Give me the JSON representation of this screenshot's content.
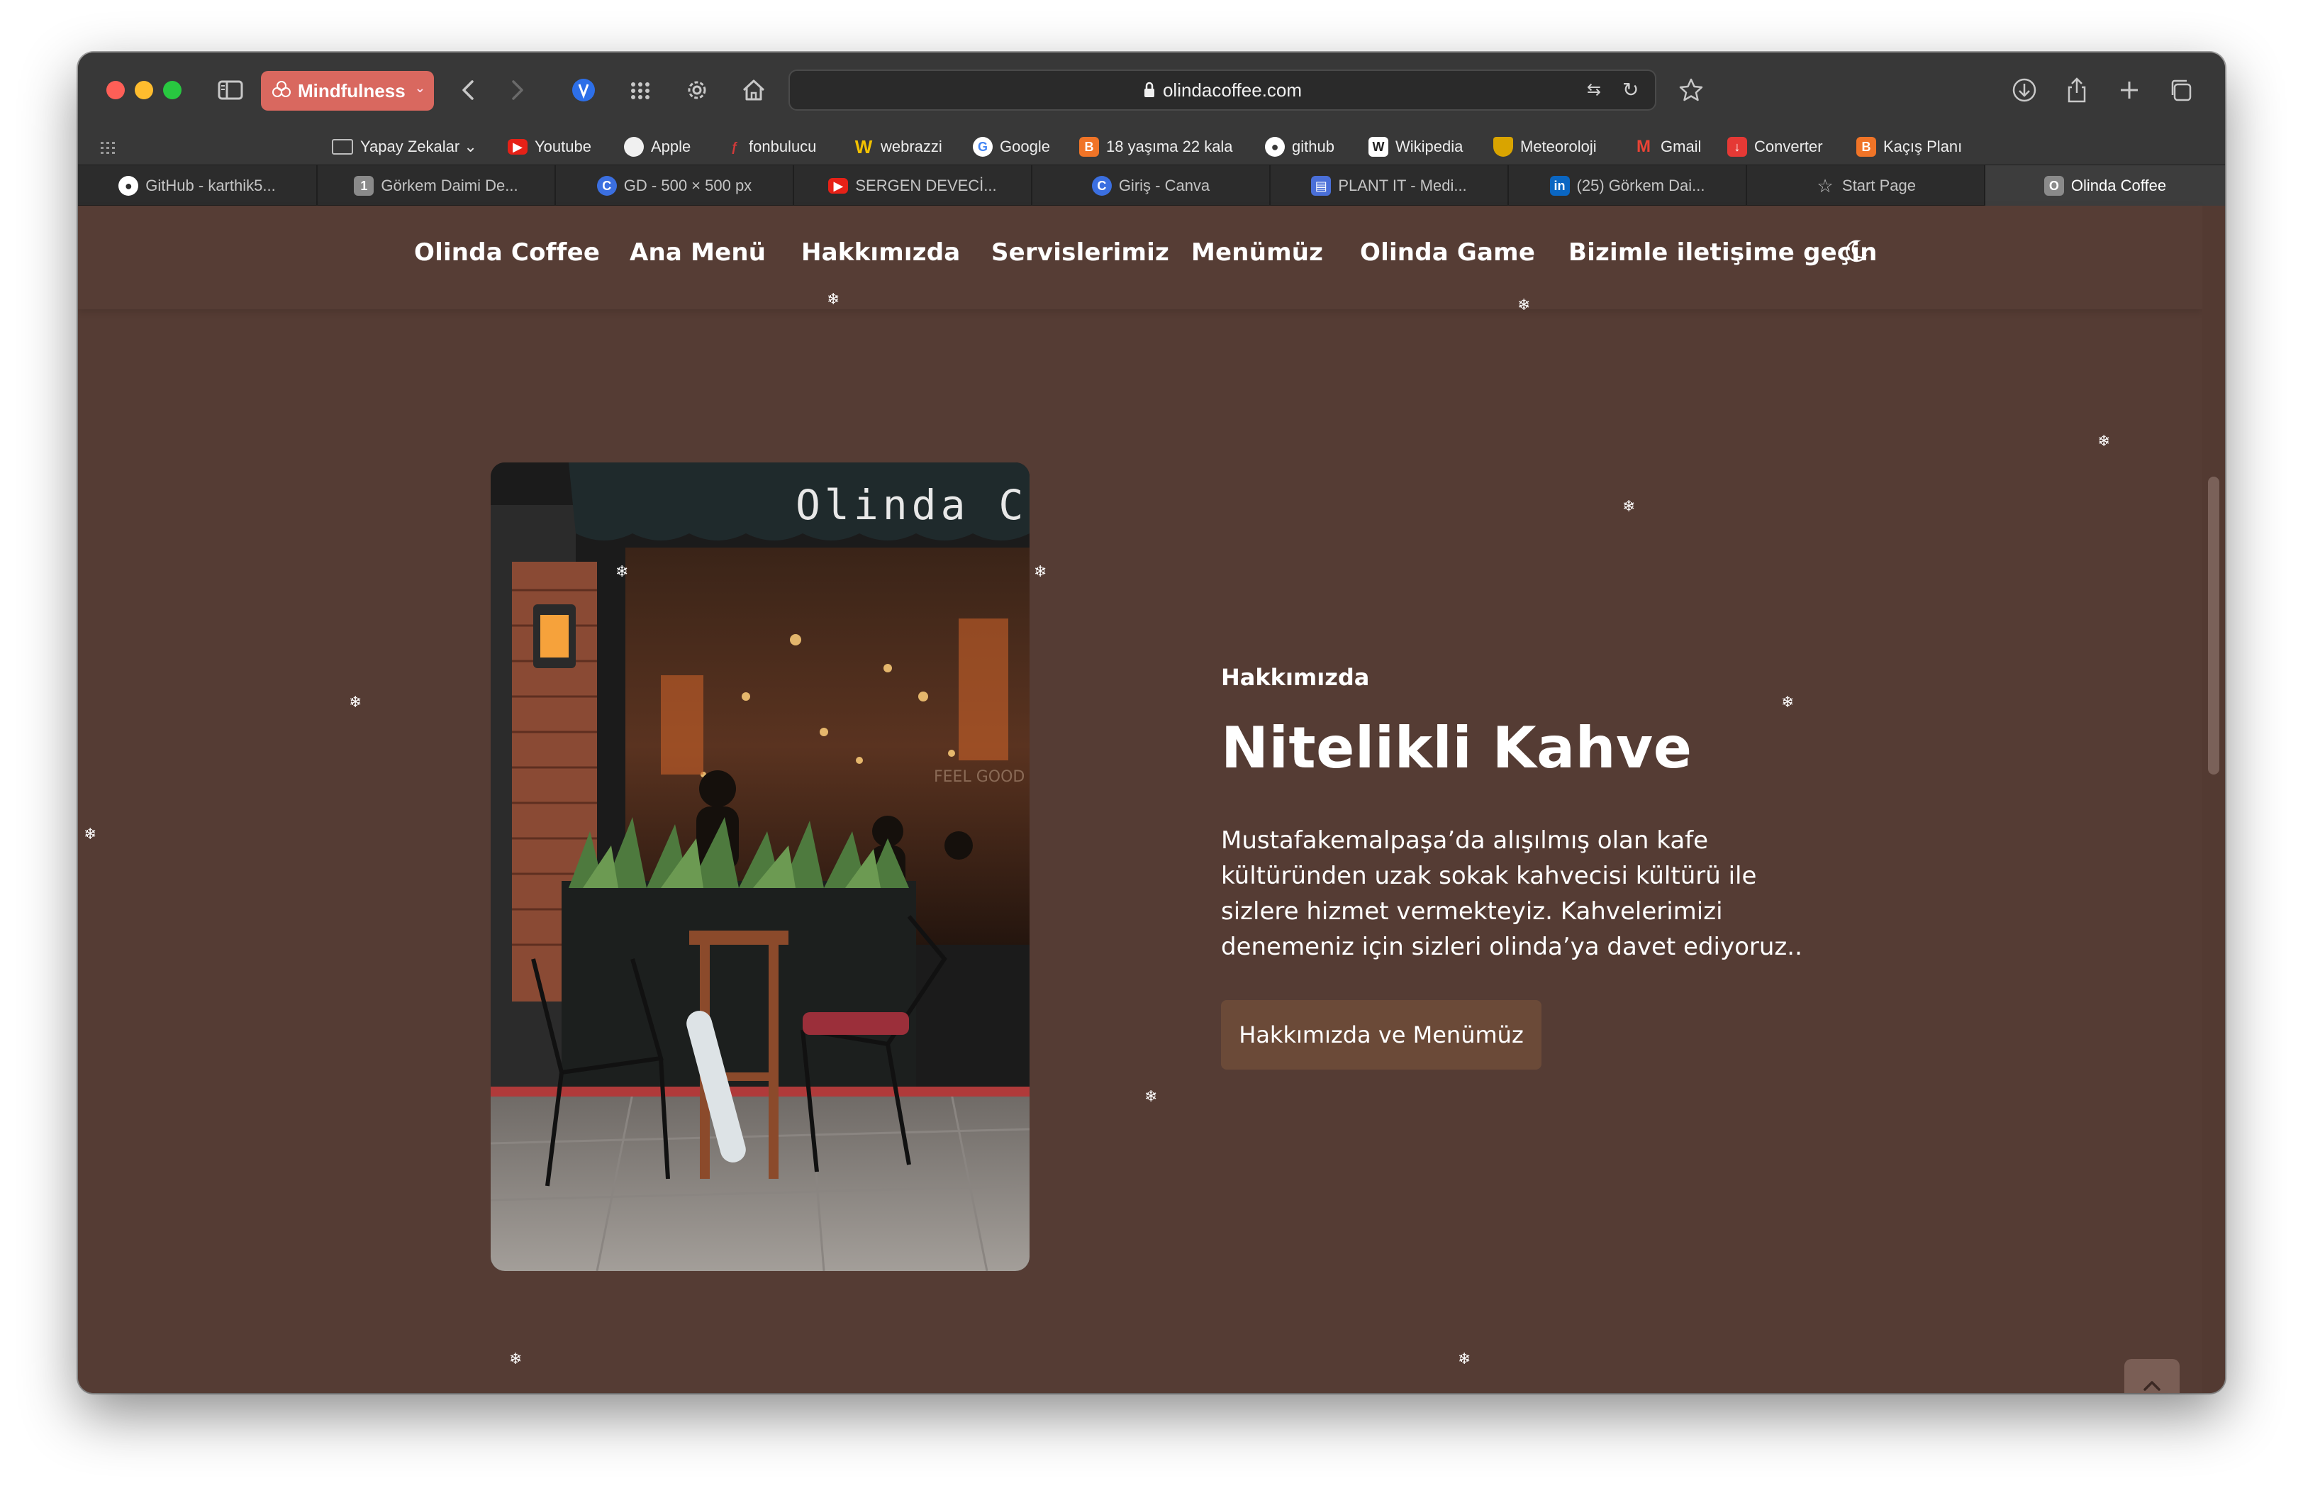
{
  "browser": {
    "profile_label": "Mindfulness",
    "url": "olindacoffee.com"
  },
  "bookmarks": [
    {
      "label": "Yapay Zekalar ⌄",
      "icon": "folder-icon",
      "color": "#383838"
    },
    {
      "label": "Youtube",
      "icon": "youtube-icon",
      "color": "#e62117"
    },
    {
      "label": "Apple",
      "icon": "apple-icon",
      "color": "#ffffff"
    },
    {
      "label": "fonbulucu",
      "icon": "fonbulucu-icon",
      "color": "#d23a3a"
    },
    {
      "label": "webrazzi",
      "icon": "webrazzi-icon",
      "color": "#f2c200"
    },
    {
      "label": "Google",
      "icon": "google-icon",
      "color": "#ffffff"
    },
    {
      "label": "18 yaşıma 22 kala",
      "icon": "blogger-icon",
      "color": "#f07427"
    },
    {
      "label": "github",
      "icon": "github-icon",
      "color": "#ffffff"
    },
    {
      "label": "Wikipedia",
      "icon": "wikipedia-icon",
      "color": "#ffffff"
    },
    {
      "label": "Meteoroloji",
      "icon": "meteoroloji-icon",
      "color": "#d9a400"
    },
    {
      "label": "Gmail",
      "icon": "gmail-icon",
      "color": "#ea4335"
    },
    {
      "label": "Converter",
      "icon": "converter-icon",
      "color": "#e53935"
    },
    {
      "label": "Kaçış Planı",
      "icon": "blogger-icon",
      "color": "#f07427"
    }
  ],
  "tabs": [
    {
      "label": "GitHub - karthik5...",
      "icon": "github-icon",
      "color": "#ffffff"
    },
    {
      "label": "Görkem Daimi De...",
      "icon": "number-one-icon",
      "color": "#888888"
    },
    {
      "label": "GD - 500 × 500 px",
      "icon": "canva-icon",
      "color": "#3b6fe0"
    },
    {
      "label": "SERGEN DEVECİ...",
      "icon": "youtube-icon",
      "color": "#e62117"
    },
    {
      "label": "Giriş - Canva",
      "icon": "canva-icon",
      "color": "#3b6fe0"
    },
    {
      "label": "PLANT IT - Medi...",
      "icon": "plantit-icon",
      "color": "#4a6fd8"
    },
    {
      "label": "(25) Görkem Dai...",
      "icon": "linkedin-icon",
      "color": "#0a66c2"
    },
    {
      "label": "Start Page",
      "icon": "star-icon",
      "color": "#2c2c2c"
    },
    {
      "label": "Olinda Coffee",
      "icon": "olinda-icon",
      "color": "#8a8a8a"
    }
  ],
  "nav": {
    "brand": "Olinda Coffee",
    "items": [
      "Ana Menü",
      "Hakkımızda",
      "Servislerimiz",
      "Menümüz",
      "Olinda Game",
      "Bizimle iletişime geçin"
    ]
  },
  "about": {
    "label": "Hakkımızda",
    "title": "Nitelikli Kahve",
    "text": "Mustafakemalpaşa’da alışılmış olan kafe kültüründen uzak sokak kahvecisi kültürü ile sizlere hizmet vermekteyiz. Kahvelerimizi denemeniz için sizleri olinda’ya davet ediyoruz..",
    "button": "Hakkımızda ve Menümüz",
    "image_sign": "Olinda Co",
    "image_sign2": "FEEL GOOD"
  },
  "colors": {
    "page_bg": "#553c34",
    "button_bg": "#6b4a38",
    "profile_pill": "#d9685f"
  }
}
